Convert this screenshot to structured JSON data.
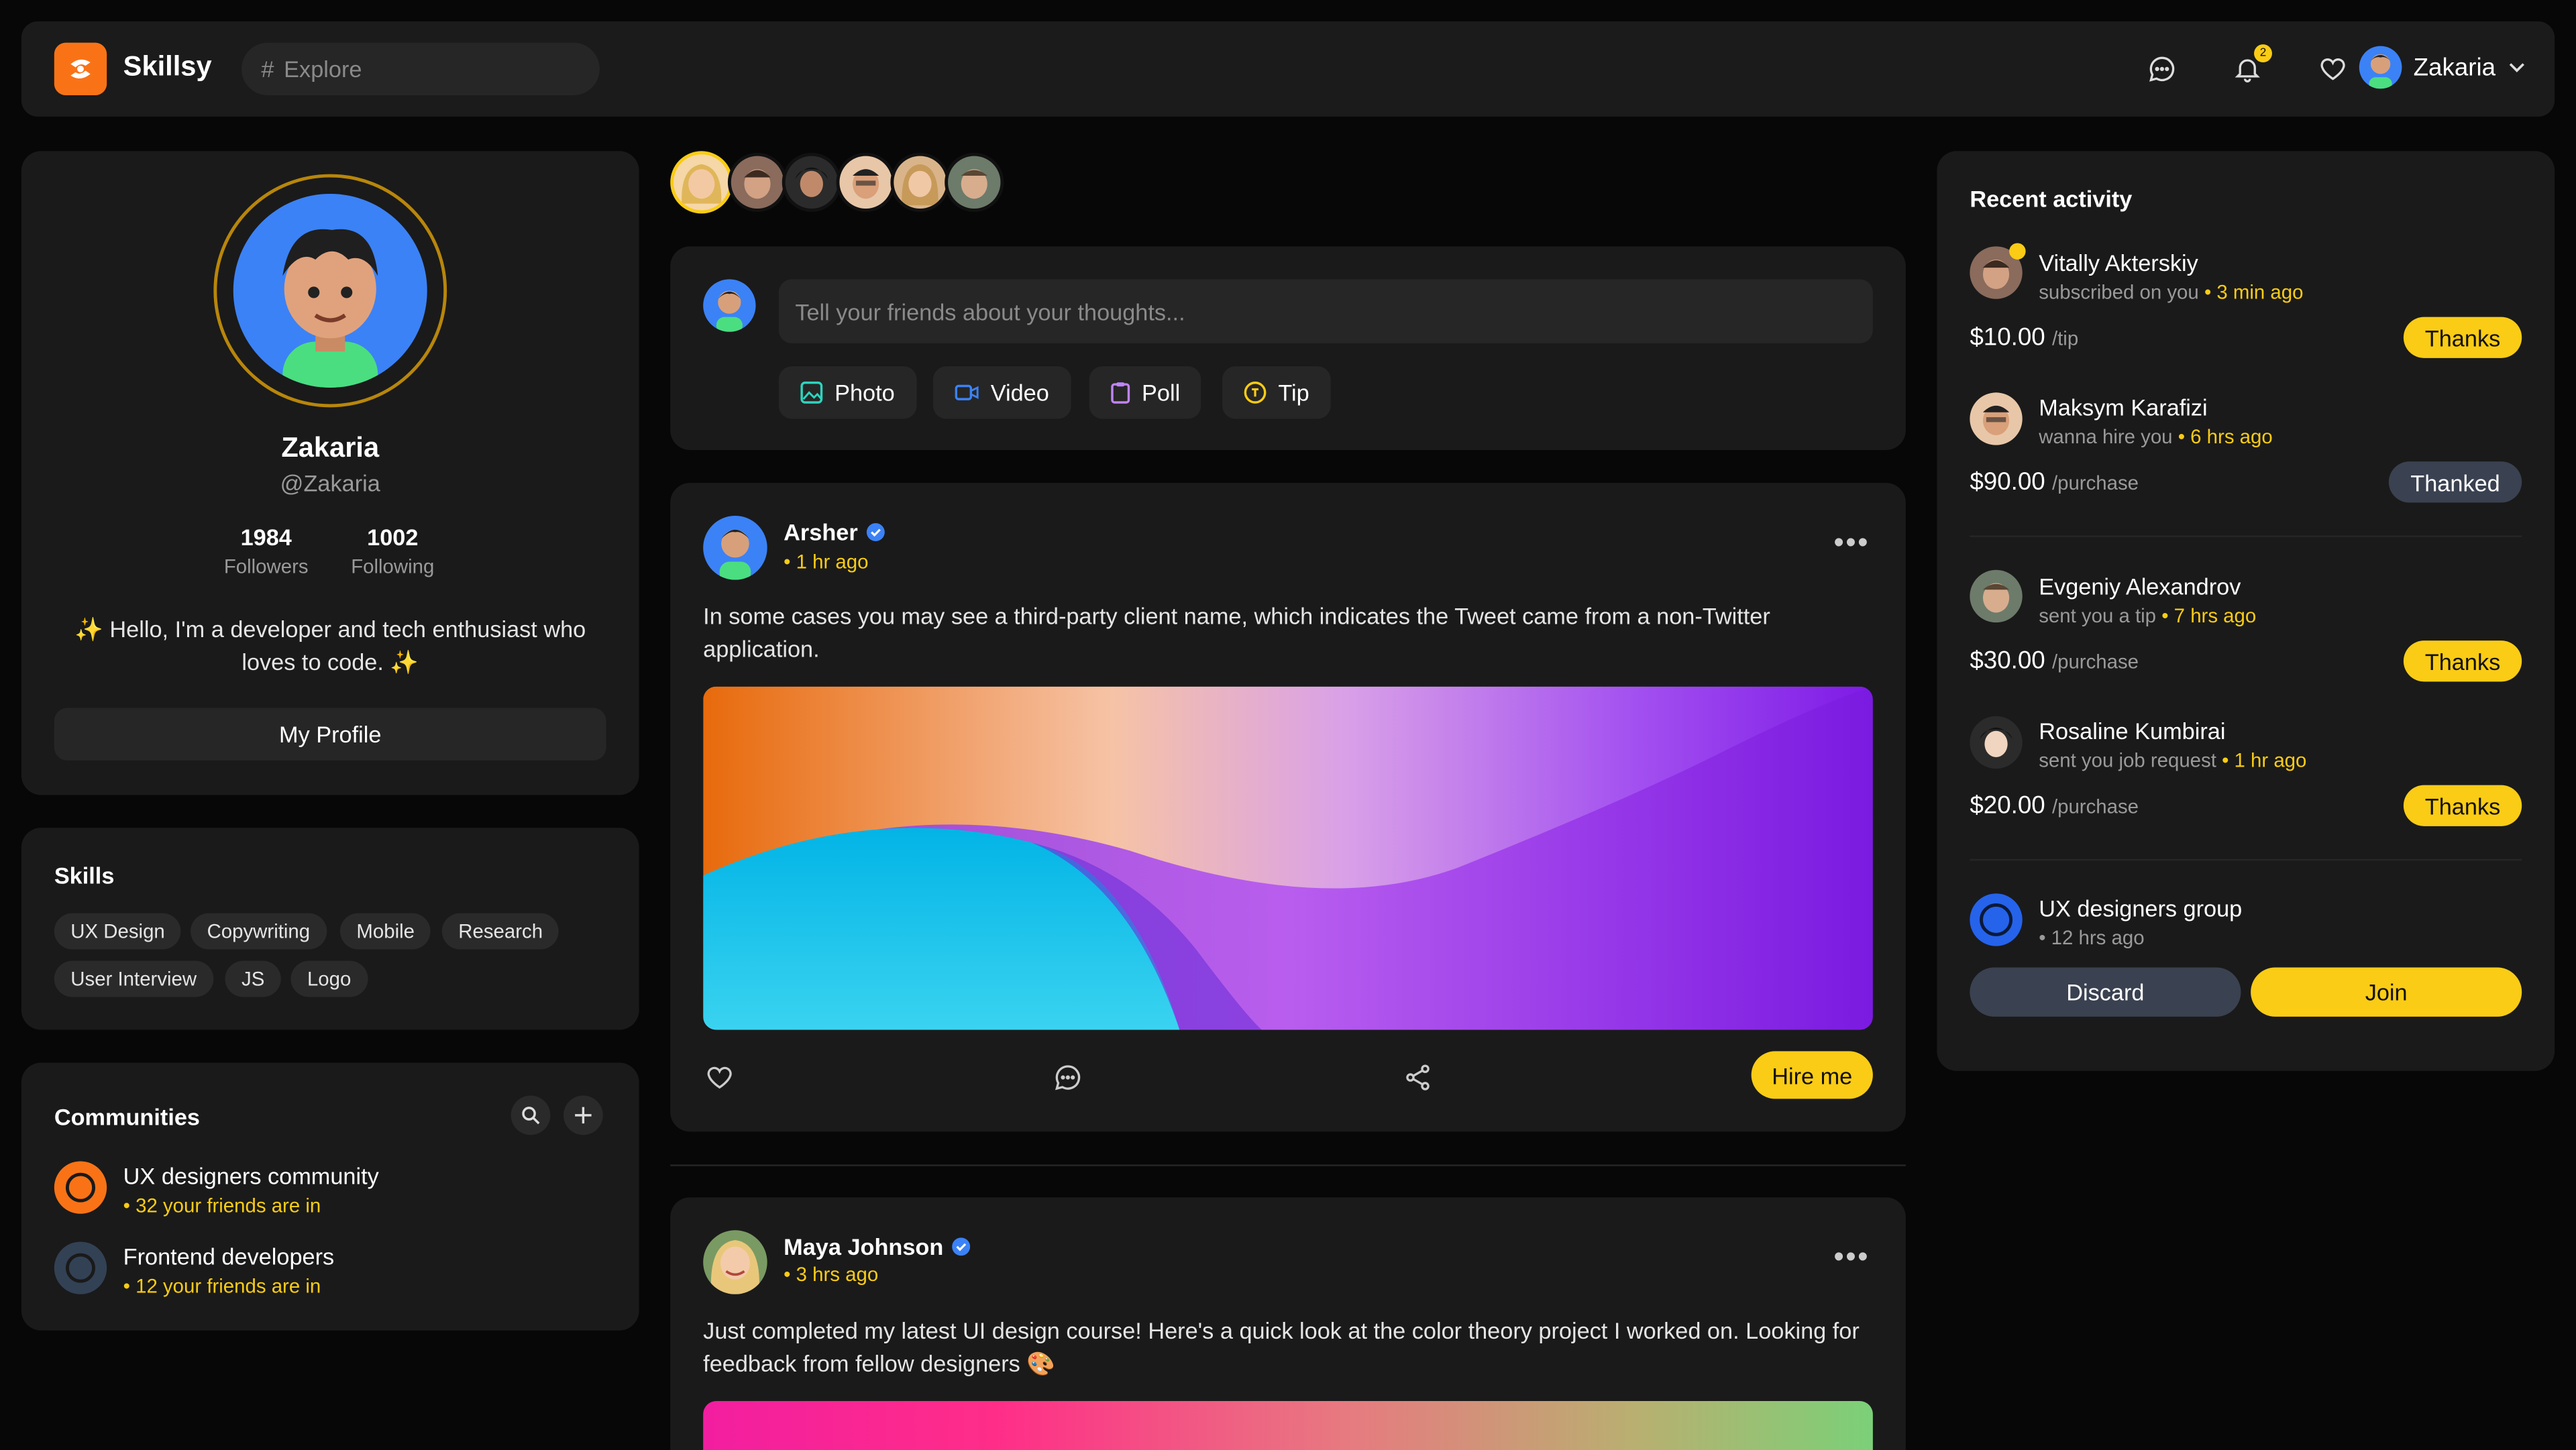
{
  "app": {
    "name": "Skillsy",
    "search_placeholder": "Explore",
    "search_prefix": "#"
  },
  "header": {
    "notification_count": "2",
    "user_name": "Zakaria"
  },
  "profile": {
    "name": "Zakaria",
    "handle": "@Zakaria",
    "followers_count": "1984",
    "followers_label": "Followers",
    "following_count": "1002",
    "following_label": "Following",
    "bio": "✨ Hello, I'm a developer and tech enthusiast who loves to code. ✨",
    "profile_button": "My Profile"
  },
  "skills": {
    "title": "Skills",
    "items": [
      "UX Design",
      "Copywriting",
      "Mobile",
      "Research",
      "User Interview",
      "JS",
      "Logo"
    ]
  },
  "communities": {
    "title": "Communities",
    "items": [
      {
        "name": "UX designers community",
        "sub": "• 32 your friends are in",
        "color": "#f97316"
      },
      {
        "name": "Frontend developers",
        "sub": "• 12 your friends are in",
        "color": "#475569"
      }
    ]
  },
  "composer": {
    "placeholder": "Tell your friends about your thoughts...",
    "buttons": [
      {
        "label": "Photo",
        "icon": "image-icon",
        "color": "#2dd4bf"
      },
      {
        "label": "Video",
        "icon": "video-icon",
        "color": "#3b82f6"
      },
      {
        "label": "Poll",
        "icon": "clipboard-icon",
        "color": "#c084fc"
      },
      {
        "label": "Tip",
        "icon": "coin-icon",
        "color": "#facc15"
      }
    ]
  },
  "posts": [
    {
      "author": "Arsher",
      "time": "• 1 hr ago",
      "text": "In some cases you may see a third-party client name, which indicates the Tweet came from a non-Twitter application.",
      "cta": "Hire me"
    },
    {
      "author": "Maya Johnson",
      "time": "• 3 hrs ago",
      "text": "Just completed my latest UI design course! Here's a quick look at the color theory project I worked on. Looking for feedback from fellow designers 🎨"
    }
  ],
  "activity": {
    "title": "Recent activity",
    "items": [
      {
        "name": "Vitally Akterskiy",
        "action": "subscribed on you",
        "time": "• 3 min ago",
        "amount": "$10.00",
        "unit": "/tip",
        "button": "Thanks"
      },
      {
        "name": "Maksym Karafizi",
        "action": "wanna hire you",
        "time": "• 6 hrs ago",
        "amount": "$90.00",
        "unit": "/purchase",
        "button": "Thanked"
      },
      {
        "name": "Evgeniy Alexandrov",
        "action": "sent you a tip",
        "time": "• 7 hrs ago",
        "amount": "$30.00",
        "unit": "/purchase",
        "button": "Thanks"
      },
      {
        "name": "Rosaline Kumbirai",
        "action": "sent you job request",
        "time": "• 1 hr ago",
        "amount": "$20.00",
        "unit": "/purchase",
        "button": "Thanks"
      }
    ],
    "group": {
      "name": "UX designers group",
      "time": "• 12 hrs ago",
      "discard": "Discard",
      "join": "Join"
    }
  },
  "colors": {
    "accent": "#facc15",
    "brand": "#f97316",
    "verified": "#3b82f6"
  }
}
